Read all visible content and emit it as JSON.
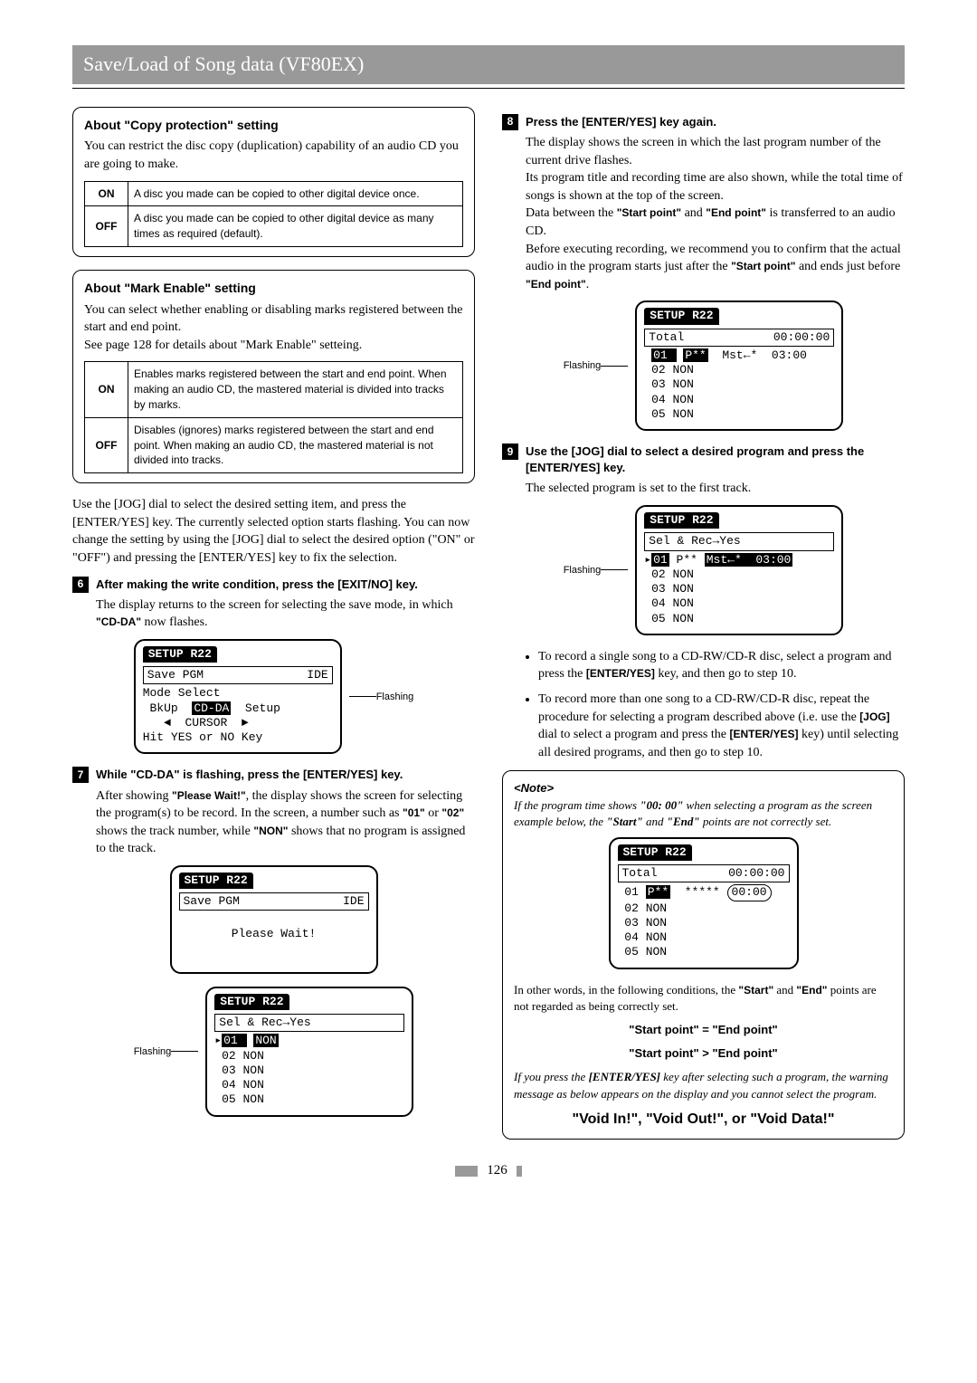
{
  "header": "Save/Load of Song data (VF80EX)",
  "copy": {
    "title": "About \"Copy protection\" setting",
    "intro": "You can restrict the disc copy (duplication) capability of an audio CD you are going to make.",
    "on_label": "ON",
    "on_desc": "A disc you made can be copied to other digital device once.",
    "off_label": "OFF",
    "off_desc": "A disc you made can be copied to other digital device as many times as required (default)."
  },
  "mark": {
    "title": "About \"Mark Enable\" setting",
    "intro1": "You can select whether enabling or disabling marks registered between the start and end point.",
    "intro2": "See page 128 for details about \"Mark Enable\" setteing.",
    "on_label": "ON",
    "on_desc": "Enables marks registered between the start and end point. When making an audio CD, the mastered material is divided into tracks by marks.",
    "off_label": "OFF",
    "off_desc": "Disables (ignores) marks registered between the start and end point. When making an audio CD, the mastered material is not divided into tracks."
  },
  "body1": "Use the [JOG] dial to select the desired setting item, and press the [ENTER/YES] key. The currently selected option starts flashing. You can now change the setting by using the [JOG] dial to select the desired option (\"ON\" or \"OFF\") and pressing the [ENTER/YES] key to fix the selection.",
  "step6": {
    "num": "6",
    "title": "After making the write condition, press the [EXIT/NO] key.",
    "body_pre": "The display returns to the screen for selecting the save mode, in which ",
    "cdda": "\"CD-DA\"",
    "body_post": " now flashes."
  },
  "lcd1": {
    "title": "SETUP R22",
    "row1a": "Save PGM",
    "row1b": "IDE",
    "l2": "Mode Select",
    "l3a": " BkUp  ",
    "l3b": "CD-DA",
    "l3c": "  Setup",
    "l4": "   ◄  CURSOR  ►",
    "l5": "Hit YES or NO Key",
    "flashing": "Flashing"
  },
  "step7": {
    "num": "7",
    "title": "While \"CD-DA\" is flashing, press the [ENTER/YES] key.",
    "b1_pre": "After showing ",
    "b1_bold": "\"Please Wait!\"",
    "b1_post": ", the display shows the screen for selecting the program(s) to be record.",
    "b2_pre": "In the screen, a number such as ",
    "b2_01": "\"01\"",
    "b2_or": " or ",
    "b2_02": "\"02\"",
    "b2_mid": " shows the track number, while ",
    "b2_non": "\"NON\"",
    "b2_post": " shows that no program is assigned to the track."
  },
  "lcd2": {
    "title": "SETUP R22",
    "row1a": "Save PGM",
    "row1b": "IDE",
    "center": "Please Wait!"
  },
  "lcd3": {
    "title": "SETUP R22",
    "row1": "Sel & Rec→Yes",
    "l01a": "01 ",
    "l01b": "NON",
    "l02": " 02 NON",
    "l03": " 03 NON",
    "l04": " 04 NON",
    "l05": " 05 NON",
    "flashing": "Flashing"
  },
  "step8": {
    "num": "8",
    "title": "Press the [ENTER/YES] key again.",
    "p1": "The display shows the screen in which the last program number of the current drive flashes.",
    "p2": "Its program title and recording time are also shown, while the total time of songs is shown at the top of the screen.",
    "p3_pre": "Data between the ",
    "p3_sp": "\"Start point\"",
    "p3_and": " and ",
    "p3_ep": "\"End point\"",
    "p3_post": " is transferred to an audio CD.",
    "p4_pre": "Before executing recording, we recommend you to confirm that the actual audio in the program starts just after the ",
    "p4_sp": "\"Start point\"",
    "p4_mid": " and ends just before ",
    "p4_ep": "\"End point\"",
    "p4_post": "."
  },
  "lcd4": {
    "title": "SETUP R22",
    "row1a": "Total",
    "row1b": "00:00:00",
    "l01a": "01 ",
    "l01b": "P**",
    "l01c": "  Mst←*  03:00",
    "l02": " 02 NON",
    "l03": " 03 NON",
    "l04": " 04 NON",
    "l05": " 05 NON",
    "flashing": "Flashing"
  },
  "step9": {
    "num": "9",
    "title": "Use the [JOG] dial to select a desired program and press the [ENTER/YES] key.",
    "body": "The selected program is set to the first track."
  },
  "lcd5": {
    "title": "SETUP R22",
    "row1": "Sel & Rec→Yes",
    "l01a": "01",
    "l01b": " P** ",
    "l01c": "Mst←*  03:00",
    "l02": " 02 NON",
    "l03": " 03 NON",
    "l04": " 04 NON",
    "l05": " 05 NON",
    "flashing": "Flashing"
  },
  "bullets": {
    "b1_pre": "To record a single song to a CD-RW/CD-R disc, select a program and press the ",
    "b1_key": "[ENTER/YES]",
    "b1_post": " key, and then go to step 10.",
    "b2_pre": "To record more than one song to a CD-RW/CD-R disc, repeat the procedure for selecting a program described above (i.e. use the ",
    "b2_jog": "[JOG]",
    "b2_mid": " dial to select a program and press the ",
    "b2_key": "[ENTER/YES]",
    "b2_post": " key) until selecting all desired programs, and then go to step 10."
  },
  "note": {
    "heading": "<Note>",
    "p1_pre": "If the program time shows ",
    "p1_time": "\"00: 00\"",
    "p1_mid": " when selecting a program as the screen example below, the ",
    "p1_start": "\"Start\"",
    "p1_and": " and ",
    "p1_end": "\"End\"",
    "p1_post": " points are not correctly set.",
    "p2_pre": "In other words, in the following conditions, the ",
    "p2_start": "\"Start\"",
    "p2_and": " and ",
    "p2_end": "\"End\"",
    "p2_post": " points are not regarded as being correctly set.",
    "eq1": "\"Start point\" = \"End point\"",
    "eq2": "\"Start point\" > \"End point\"",
    "p3_pre": "If you press the ",
    "p3_key": "[ENTER/YES]",
    "p3_post": " key after selecting such a program, the warning message as below appears on the display and you cannot select the program.",
    "void": "\"Void In!\", \"Void Out!\", or \"Void Data!\""
  },
  "lcd6": {
    "title": "SETUP R22",
    "row1a": "Total",
    "row1b": "00:00:00",
    "l01a": " 01 ",
    "l01b": "P**",
    "l01c": "  ***** ",
    "l01d": "00:00",
    "l02": " 02 NON",
    "l03": " 03 NON",
    "l04": " 04 NON",
    "l05": " 05 NON"
  },
  "page": "126"
}
